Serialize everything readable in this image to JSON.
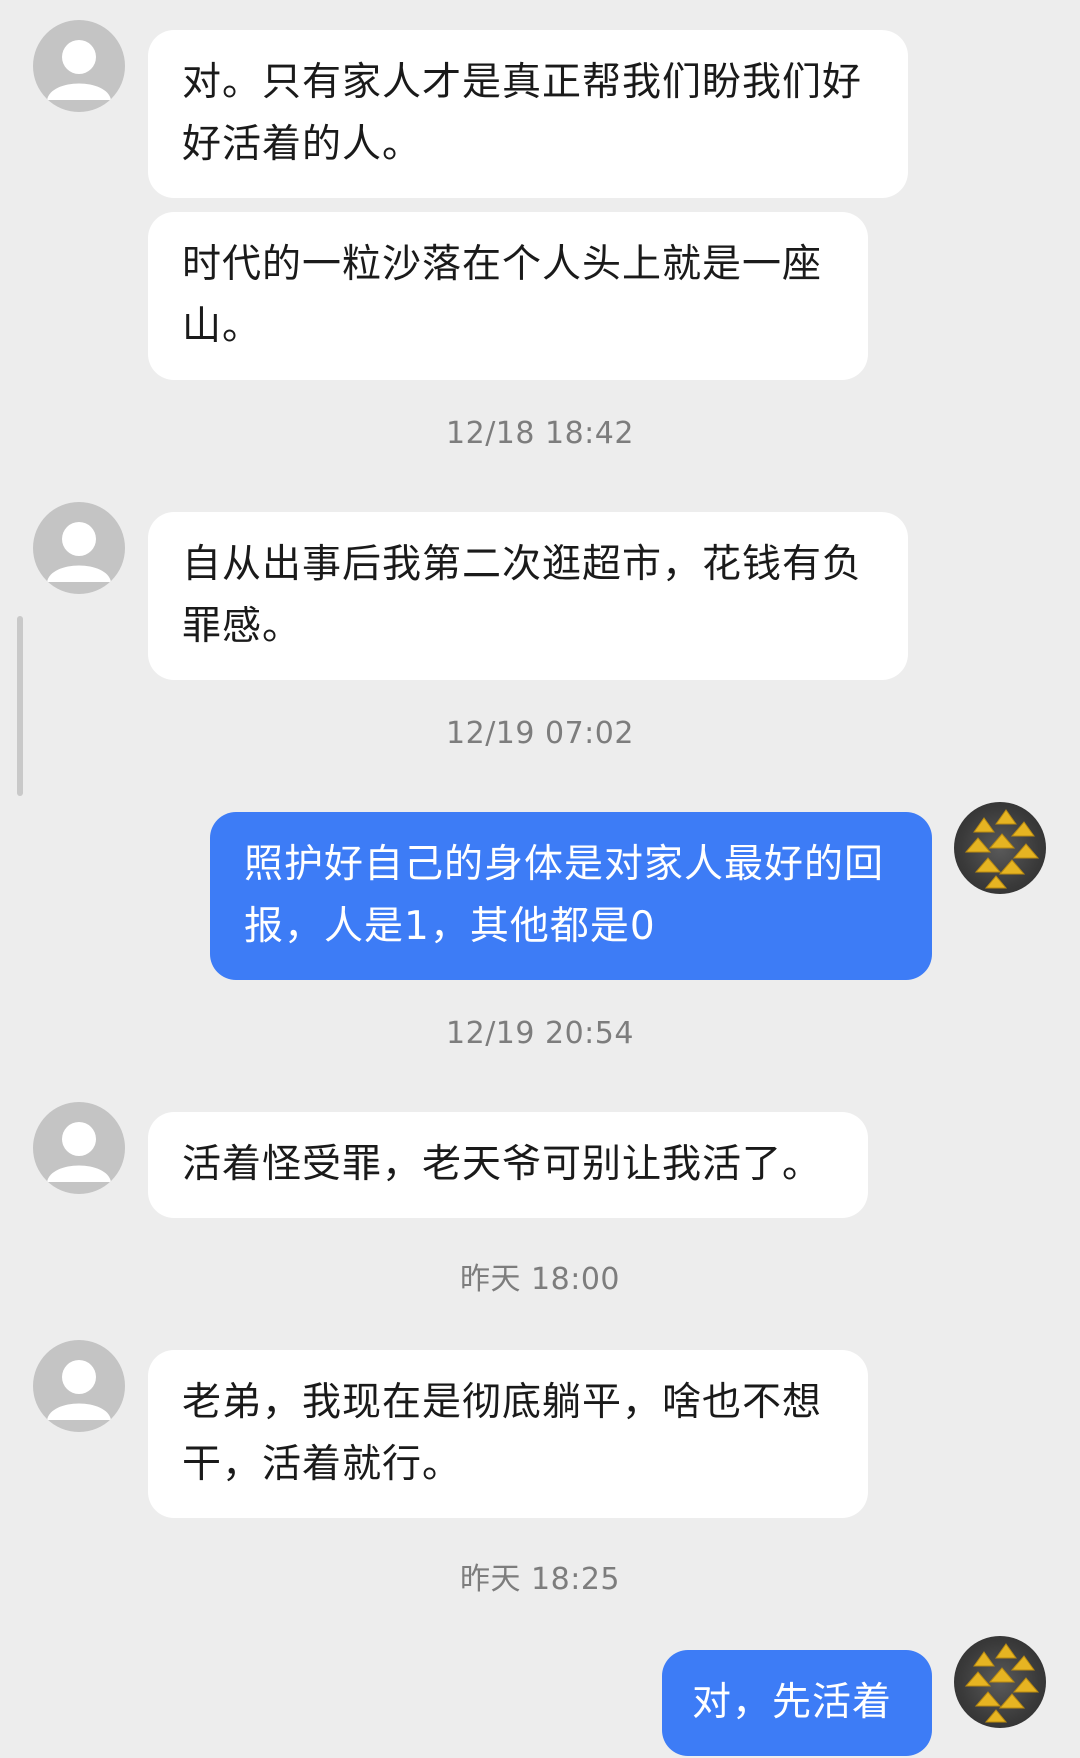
{
  "messages": [
    {
      "from": "other",
      "text": "对。只有家人才是真正帮我们盼我们好好活着的人。"
    },
    {
      "from": "other",
      "text": "时代的一粒沙落在个人头上就是一座山。"
    },
    {
      "timestamp": "12/18 18:42"
    },
    {
      "from": "other",
      "text": "自从出事后我第二次逛超市，花钱有负罪感。"
    },
    {
      "timestamp": "12/19 07:02"
    },
    {
      "from": "self",
      "text": "照护好自己的身体是对家人最好的回报，人是1，其他都是0"
    },
    {
      "timestamp": "12/19 20:54"
    },
    {
      "from": "other",
      "text": "活着怪受罪，老天爷可别让我活了。"
    },
    {
      "timestamp": "昨天 18:00"
    },
    {
      "from": "other",
      "text": "老弟，我现在是彻底躺平，啥也不想干，活着就行。"
    },
    {
      "timestamp": "昨天 18:25"
    },
    {
      "from": "self",
      "text": "对，先活着"
    }
  ],
  "icons": {
    "other_avatar": "default-person-avatar",
    "self_avatar": "ginkgo-leaves-avatar"
  },
  "colors": {
    "background": "#ededed",
    "incoming_bubble": "#ffffff",
    "outgoing_bubble": "#3d7cf6",
    "timestamp_text": "#7d7d7d"
  }
}
